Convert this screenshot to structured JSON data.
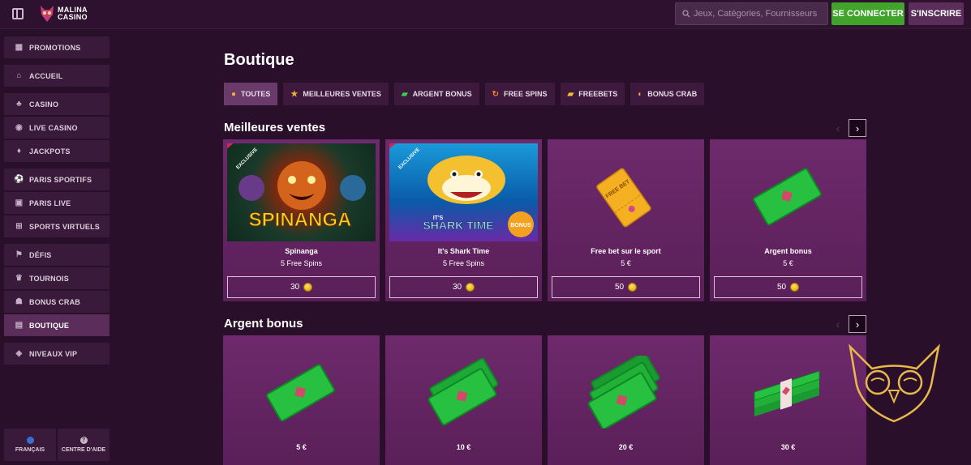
{
  "header": {
    "logo_line1": "MALINA",
    "logo_line2": "CASINO",
    "search_placeholder": "Jeux, Catégories, Fournisseurs",
    "login_label": "SE CONNECTER",
    "register_label": "S'INSCRIRE"
  },
  "sidebar": {
    "items": [
      {
        "label": "PROMOTIONS",
        "icon": "gift-icon"
      },
      {
        "label": "ACCUEIL",
        "icon": "home-icon"
      },
      {
        "label": "CASINO",
        "icon": "casino-icon"
      },
      {
        "label": "LIVE CASINO",
        "icon": "live-icon"
      },
      {
        "label": "JACKPOTS",
        "icon": "jackpot-icon"
      },
      {
        "label": "PARIS SPORTIFS",
        "icon": "football-icon"
      },
      {
        "label": "PARIS LIVE",
        "icon": "live-bet-icon"
      },
      {
        "label": "SPORTS VIRTUELS",
        "icon": "virtual-icon"
      },
      {
        "label": "DÉFIS",
        "icon": "challenge-icon"
      },
      {
        "label": "TOURNOIS",
        "icon": "trophy-icon"
      },
      {
        "label": "BONUS CRAB",
        "icon": "crab-icon"
      },
      {
        "label": "BOUTIQUE",
        "icon": "shop-icon"
      },
      {
        "label": "NIVEAUX VIP",
        "icon": "vip-icon"
      }
    ],
    "language_label": "FRANÇAIS",
    "help_label": "CENTRE D'AIDE"
  },
  "main": {
    "title": "Boutique",
    "tabs": [
      {
        "label": "TOUTES",
        "icon": "all-icon"
      },
      {
        "label": "MEILLEURES VENTES",
        "icon": "star-icon"
      },
      {
        "label": "ARGENT BONUS",
        "icon": "money-icon"
      },
      {
        "label": "FREE SPINS",
        "icon": "spin-icon"
      },
      {
        "label": "FREEBETS",
        "icon": "ticket-icon"
      },
      {
        "label": "BONUS CRAB",
        "icon": "crab-icon"
      }
    ],
    "best_sellers": {
      "title": "Meilleures ventes",
      "cards": [
        {
          "name": "Spinanga",
          "sub": "5 Free Spins",
          "price": "30",
          "badge": "EXCLUSIVE",
          "game_title": "SPINANGA"
        },
        {
          "name": "It's Shark Time",
          "sub": "5 Free Spins",
          "price": "30",
          "badge": "EXCLUSIVE",
          "game_title": "SHARK TIME",
          "game_prefix": "IT'S",
          "game_badge": "BONUS"
        },
        {
          "name": "Free bet sur le sport",
          "sub": "5 €",
          "price": "50",
          "ticket_text": "FREE BET"
        },
        {
          "name": "Argent bonus",
          "sub": "5 €",
          "price": "50"
        }
      ]
    },
    "bonus_money": {
      "title": "Argent bonus",
      "cards": [
        {
          "name": "5 €"
        },
        {
          "name": "10 €"
        },
        {
          "name": "20 €"
        },
        {
          "name": "30 €"
        }
      ]
    }
  },
  "colors": {
    "accent_green": "#41a42a",
    "card_purple": "#6e2a6c",
    "bg": "#2a0f2a"
  }
}
